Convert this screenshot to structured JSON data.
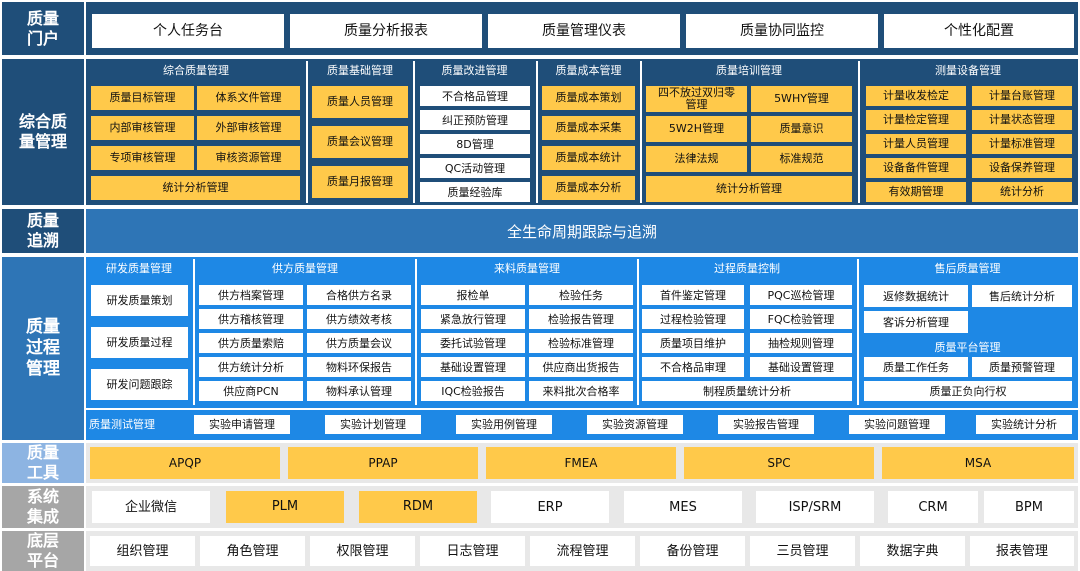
{
  "rows": {
    "portal": "质量\n门户",
    "integrated": "综合质\n量管理",
    "trace": "质量\n追溯",
    "process": "质量\n过程\n管理",
    "tools": "质量\n工具",
    "system": "系统\n集成",
    "platform": "底层\n平台"
  },
  "portal": [
    "个人任务台",
    "质量分析报表",
    "质量管理仪表",
    "质量协同监控",
    "个性化配置"
  ],
  "integrated": {
    "zonghe": {
      "title": "综合质量管理",
      "items": [
        "质量目标管理",
        "体系文件管理",
        "内部审核管理",
        "外部审核管理",
        "专项审核管理",
        "审核资源管理"
      ],
      "bottom": "统计分析管理"
    },
    "jichu": {
      "title": "质量基础管理",
      "items": [
        "质量人员管理",
        "质量会议管理",
        "质量月报管理"
      ]
    },
    "gaijin": {
      "title": "质量改进管理",
      "items": [
        "不合格品管理",
        "纠正预防管理",
        "8D管理",
        "QC活动管理",
        "质量经验库"
      ]
    },
    "chengben": {
      "title": "质量成本管理",
      "items": [
        "质量成本策划",
        "质量成本采集",
        "质量成本统计",
        "质量成本分析"
      ]
    },
    "peixun": {
      "title": "质量培训管理",
      "items": [
        "四不放过双归零管理",
        "5WHY管理",
        "5W2H管理",
        "质量意识",
        "法律法规",
        "标准规范"
      ],
      "bottom": "统计分析管理"
    },
    "celiang": {
      "title": "测量设备管理",
      "items": [
        "计量收发检定",
        "计量台账管理",
        "计量检定管理",
        "计量状态管理",
        "计量人员管理",
        "计量标准管理",
        "设备备件管理",
        "设备保养管理",
        "有效期管理",
        "统计分析"
      ]
    }
  },
  "trace": "全生命周期跟踪与追溯",
  "process": {
    "rd": {
      "title": "研发质量管理",
      "items": [
        "研发质量策划",
        "研发质量过程",
        "研发问题跟踪"
      ]
    },
    "supplier": {
      "title": "供方质量管理",
      "items": [
        "供方档案管理",
        "合格供方名录",
        "供方稽核管理",
        "供方绩效考核",
        "供方质量索赔",
        "供方质量会议",
        "供方统计分析",
        "物料环保报告",
        "供应商PCN",
        "物料承认管理"
      ]
    },
    "incoming": {
      "title": "来料质量管理",
      "items": [
        "报检单",
        "检验任务",
        "紧急放行管理",
        "检验报告管理",
        "委托试验管理",
        "检验标准管理",
        "基础设置管理",
        "供应商出货报告",
        "IQC检验报告",
        "来料批次合格率"
      ]
    },
    "control": {
      "title": "过程质量控制",
      "items": [
        "首件鉴定管理",
        "PQC巡检管理",
        "过程检验管理",
        "FQC检验管理",
        "质量项目维护",
        "抽检规则管理",
        "不合格品审理",
        "基础设置管理"
      ],
      "bottom": "制程质量统计分析"
    },
    "after": {
      "title": "售后质量管理",
      "items": [
        "返修数据统计",
        "售后统计分析",
        "客诉分析管理"
      ]
    },
    "qplat": {
      "title": "质量平台管理",
      "items": [
        "质量工作任务",
        "质量预警管理"
      ],
      "bottom": "质量正负向行权"
    },
    "test": {
      "title": "质量测试管理",
      "items": [
        "实验申请管理",
        "实验计划管理",
        "实验用例管理",
        "实验资源管理",
        "实验报告管理",
        "实验问题管理",
        "实验统计分析"
      ]
    }
  },
  "tools": [
    "APQP",
    "PPAP",
    "FMEA",
    "SPC",
    "MSA"
  ],
  "system": [
    "企业微信",
    "PLM",
    "RDM",
    "ERP",
    "MES",
    "ISP/SRM",
    "CRM",
    "BPM"
  ],
  "platform": [
    "组织管理",
    "角色管理",
    "权限管理",
    "日志管理",
    "流程管理",
    "备份管理",
    "三员管理",
    "数据字典",
    "报表管理"
  ],
  "colors": {
    "navy": "#1f4e79",
    "blue": "#2e75b6",
    "bright": "#1e88e5",
    "gold": "#ffc94a",
    "grey": "#a6a6a6",
    "lightgrey": "#e8e8e8",
    "lightblue": "#8db4e2"
  }
}
